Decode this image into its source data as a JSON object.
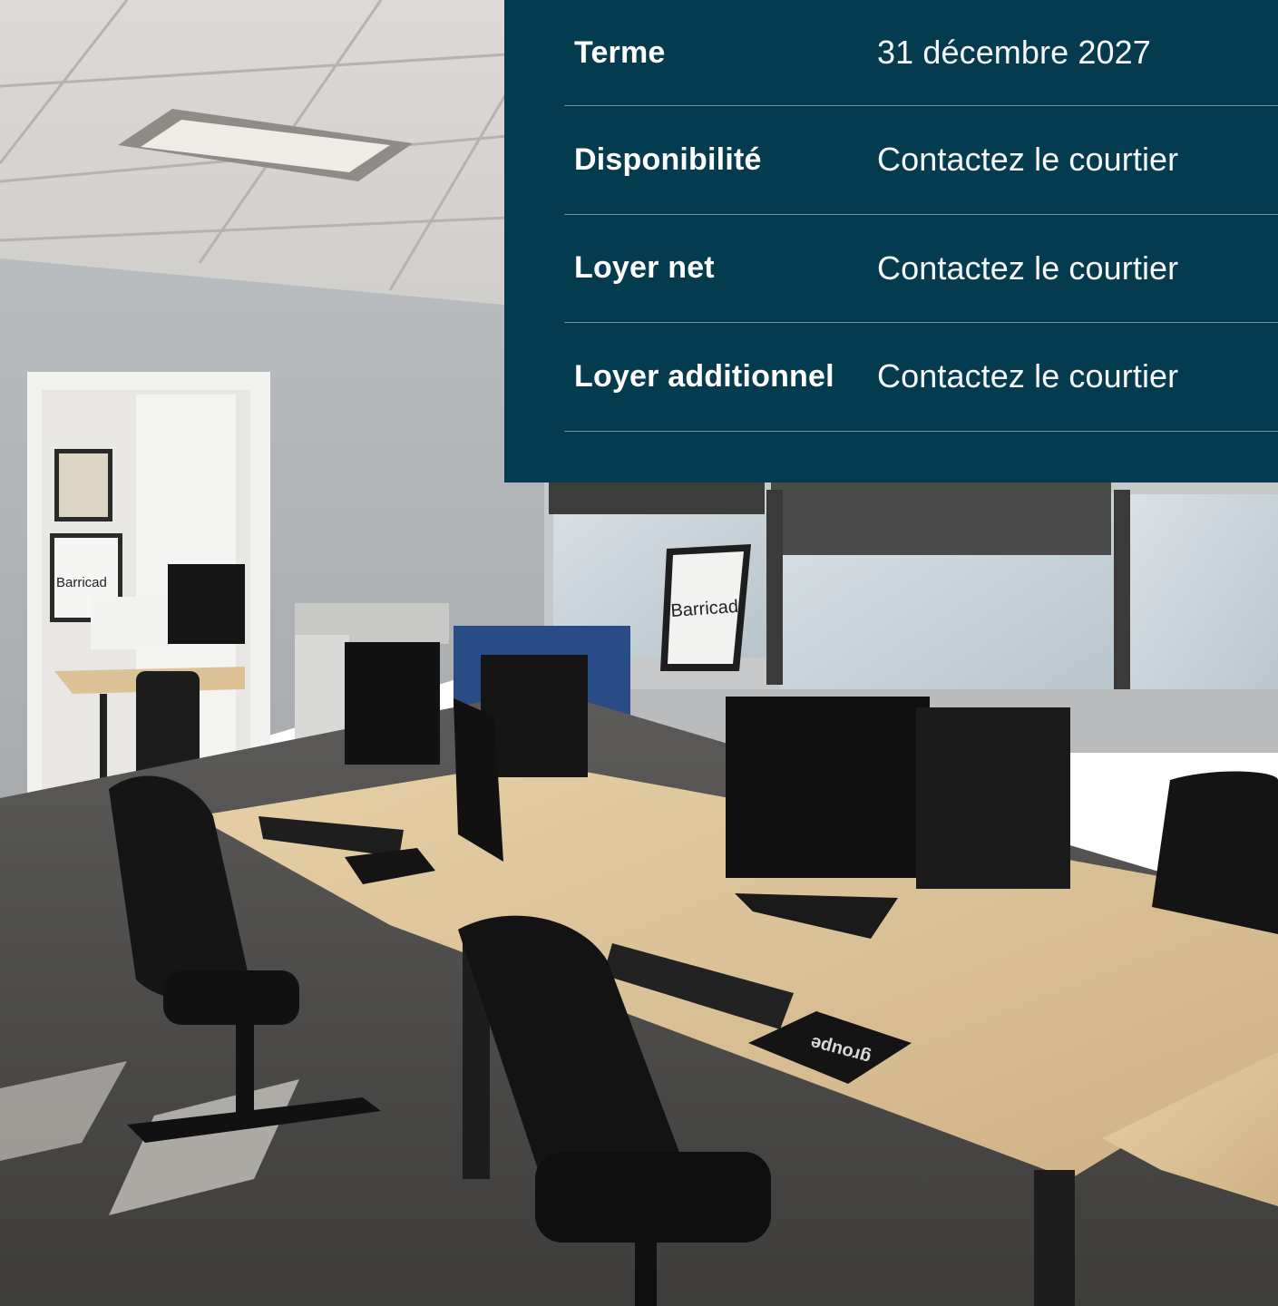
{
  "photo": {
    "description_icon": "office-photo-icon",
    "poster_text_1": "Barricad",
    "poster_text_2": "Barricad",
    "mousepad_text": "groupe"
  },
  "details": [
    {
      "label": "Terme",
      "value": "31 décembre 2027"
    },
    {
      "label": "Disponibilité",
      "value": "Contactez le courtier"
    },
    {
      "label": "Loyer net",
      "value": "Contactez le courtier"
    },
    {
      "label": "Loyer additionnel",
      "value": "Contactez le courtier"
    }
  ],
  "colors": {
    "panel_background": "#053b4f",
    "panel_text": "#ffffff"
  }
}
